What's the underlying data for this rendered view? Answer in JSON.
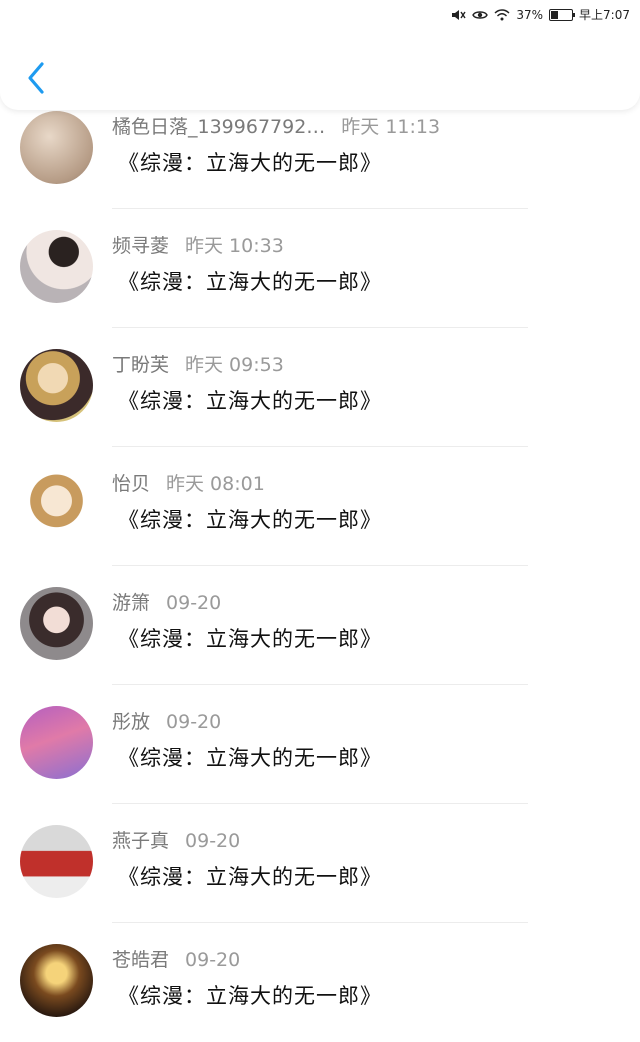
{
  "status": {
    "battery": "37%",
    "time": "早上7:07",
    "icons": [
      "mute-icon",
      "eye-icon",
      "wifi-icon",
      "battery-icon"
    ],
    "battery_level": 0.37
  },
  "header": {
    "back_icon": "chevron-left-icon"
  },
  "colors": {
    "accent": "#1e9bf0"
  },
  "items": [
    {
      "name": "橘色日落_139967792…",
      "time": "昨天 11:13",
      "message": "《综漫：立海大的无一郎》"
    },
    {
      "name": "频寻菱",
      "time": "昨天 10:33",
      "message": "《综漫：立海大的无一郎》"
    },
    {
      "name": "丁盼芙",
      "time": "昨天 09:53",
      "message": "《综漫：立海大的无一郎》"
    },
    {
      "name": "怡贝",
      "time": "昨天 08:01",
      "message": "《综漫：立海大的无一郎》"
    },
    {
      "name": "游箫",
      "time": "09-20",
      "message": "《综漫：立海大的无一郎》"
    },
    {
      "name": "彤放",
      "time": "09-20",
      "message": "《综漫：立海大的无一郎》"
    },
    {
      "name": "燕子真",
      "time": "09-20",
      "message": "《综漫：立海大的无一郎》"
    },
    {
      "name": "苍皓君",
      "time": "09-20",
      "message": "《综漫：立海大的无一郎》"
    }
  ]
}
